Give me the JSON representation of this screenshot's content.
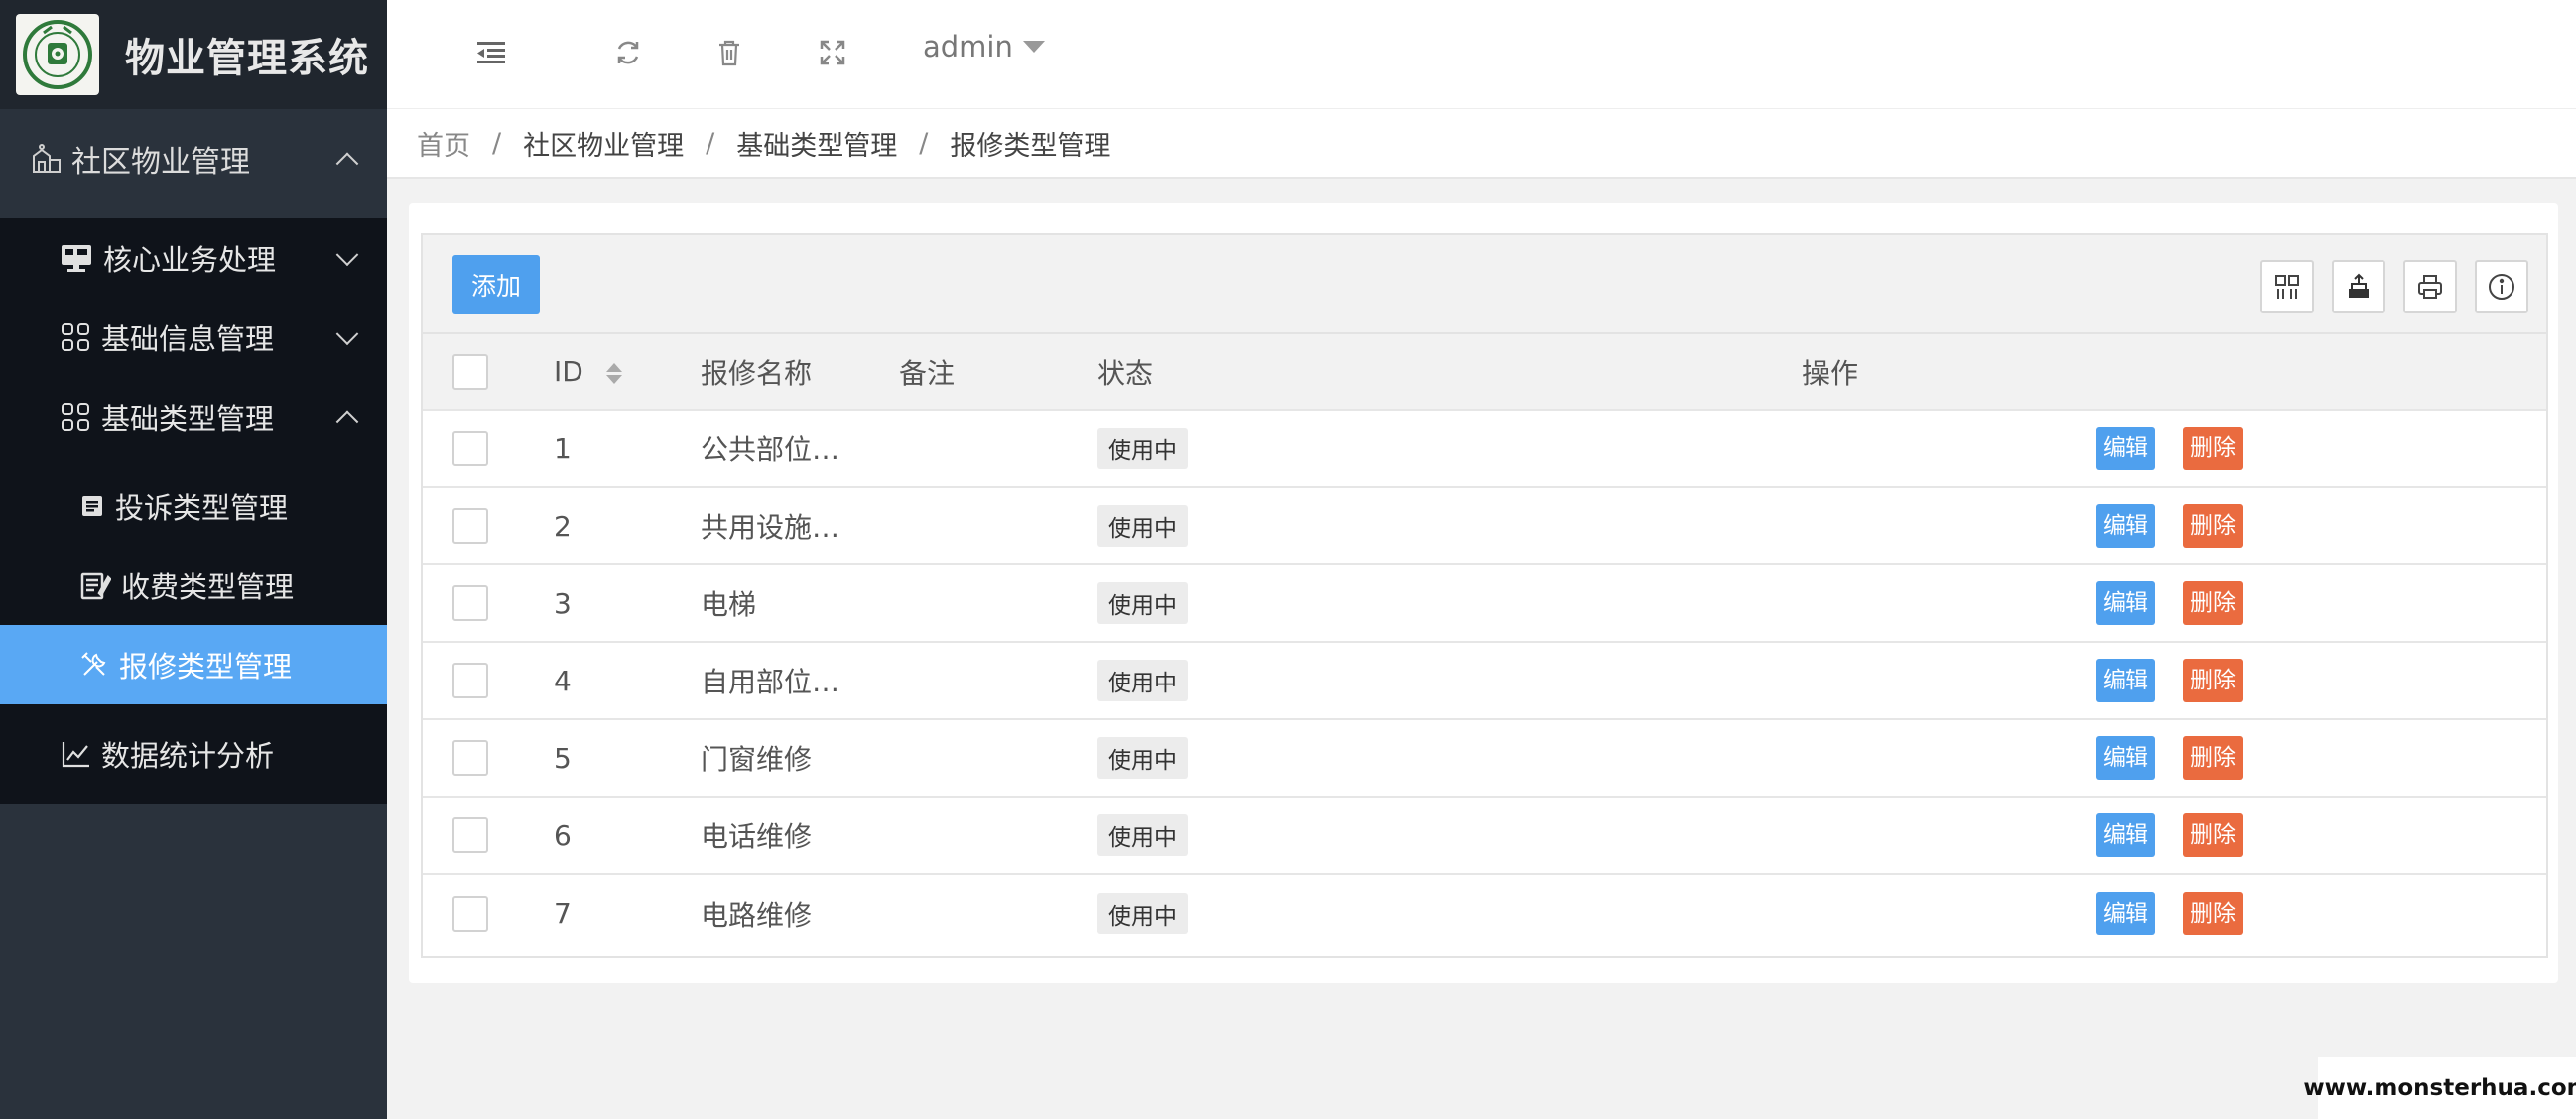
{
  "app": {
    "title": "物业管理系统"
  },
  "sidebar": {
    "top": {
      "label": "社区物业管理"
    },
    "groups": [
      {
        "label": "核心业务处理"
      },
      {
        "label": "基础信息管理"
      },
      {
        "label": "基础类型管理"
      }
    ],
    "sub_items": [
      {
        "label": "投诉类型管理"
      },
      {
        "label": "收费类型管理"
      },
      {
        "label": "报修类型管理"
      }
    ],
    "stats": {
      "label": "数据统计分析"
    },
    "active_color": "#59a8f4"
  },
  "topbar": {
    "user": "admin"
  },
  "breadcrumb": {
    "home": "首页",
    "items": [
      "社区物业管理",
      "基础类型管理",
      "报修类型管理"
    ],
    "separator": "/"
  },
  "toolbar": {
    "add_label": "添加"
  },
  "table": {
    "headers": {
      "id": "ID",
      "name": "报修名称",
      "remark": "备注",
      "status": "状态",
      "ops": "操作"
    },
    "edit_label": "编辑",
    "delete_label": "删除",
    "rows": [
      {
        "id": "1",
        "name": "公共部位…",
        "remark": "",
        "status": "使用中"
      },
      {
        "id": "2",
        "name": "共用设施…",
        "remark": "",
        "status": "使用中"
      },
      {
        "id": "3",
        "name": "电梯",
        "remark": "",
        "status": "使用中"
      },
      {
        "id": "4",
        "name": "自用部位…",
        "remark": "",
        "status": "使用中"
      },
      {
        "id": "5",
        "name": "门窗维修",
        "remark": "",
        "status": "使用中"
      },
      {
        "id": "6",
        "name": "电话维修",
        "remark": "",
        "status": "使用中"
      },
      {
        "id": "7",
        "name": "电路维修",
        "remark": "",
        "status": "使用中"
      }
    ]
  },
  "watermark": "www.monsterhua.com",
  "colors": {
    "primary": "#4fa0ee",
    "danger": "#ea6b3f",
    "sidebar_bg": "#2a323c"
  }
}
